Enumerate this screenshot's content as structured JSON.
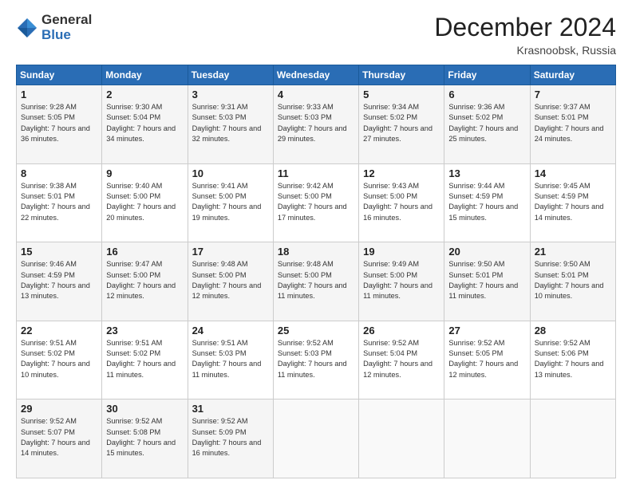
{
  "logo": {
    "general": "General",
    "blue": "Blue"
  },
  "title": "December 2024",
  "location": "Krasnoobsk, Russia",
  "days_of_week": [
    "Sunday",
    "Monday",
    "Tuesday",
    "Wednesday",
    "Thursday",
    "Friday",
    "Saturday"
  ],
  "weeks": [
    [
      {
        "day": "1",
        "sunrise": "9:28 AM",
        "sunset": "5:05 PM",
        "daylight": "7 hours and 36 minutes."
      },
      {
        "day": "2",
        "sunrise": "9:30 AM",
        "sunset": "5:04 PM",
        "daylight": "7 hours and 34 minutes."
      },
      {
        "day": "3",
        "sunrise": "9:31 AM",
        "sunset": "5:03 PM",
        "daylight": "7 hours and 32 minutes."
      },
      {
        "day": "4",
        "sunrise": "9:33 AM",
        "sunset": "5:03 PM",
        "daylight": "7 hours and 29 minutes."
      },
      {
        "day": "5",
        "sunrise": "9:34 AM",
        "sunset": "5:02 PM",
        "daylight": "7 hours and 27 minutes."
      },
      {
        "day": "6",
        "sunrise": "9:36 AM",
        "sunset": "5:02 PM",
        "daylight": "7 hours and 25 minutes."
      },
      {
        "day": "7",
        "sunrise": "9:37 AM",
        "sunset": "5:01 PM",
        "daylight": "7 hours and 24 minutes."
      }
    ],
    [
      {
        "day": "8",
        "sunrise": "9:38 AM",
        "sunset": "5:01 PM",
        "daylight": "7 hours and 22 minutes."
      },
      {
        "day": "9",
        "sunrise": "9:40 AM",
        "sunset": "5:00 PM",
        "daylight": "7 hours and 20 minutes."
      },
      {
        "day": "10",
        "sunrise": "9:41 AM",
        "sunset": "5:00 PM",
        "daylight": "7 hours and 19 minutes."
      },
      {
        "day": "11",
        "sunrise": "9:42 AM",
        "sunset": "5:00 PM",
        "daylight": "7 hours and 17 minutes."
      },
      {
        "day": "12",
        "sunrise": "9:43 AM",
        "sunset": "5:00 PM",
        "daylight": "7 hours and 16 minutes."
      },
      {
        "day": "13",
        "sunrise": "9:44 AM",
        "sunset": "4:59 PM",
        "daylight": "7 hours and 15 minutes."
      },
      {
        "day": "14",
        "sunrise": "9:45 AM",
        "sunset": "4:59 PM",
        "daylight": "7 hours and 14 minutes."
      }
    ],
    [
      {
        "day": "15",
        "sunrise": "9:46 AM",
        "sunset": "4:59 PM",
        "daylight": "7 hours and 13 minutes."
      },
      {
        "day": "16",
        "sunrise": "9:47 AM",
        "sunset": "5:00 PM",
        "daylight": "7 hours and 12 minutes."
      },
      {
        "day": "17",
        "sunrise": "9:48 AM",
        "sunset": "5:00 PM",
        "daylight": "7 hours and 12 minutes."
      },
      {
        "day": "18",
        "sunrise": "9:48 AM",
        "sunset": "5:00 PM",
        "daylight": "7 hours and 11 minutes."
      },
      {
        "day": "19",
        "sunrise": "9:49 AM",
        "sunset": "5:00 PM",
        "daylight": "7 hours and 11 minutes."
      },
      {
        "day": "20",
        "sunrise": "9:50 AM",
        "sunset": "5:01 PM",
        "daylight": "7 hours and 11 minutes."
      },
      {
        "day": "21",
        "sunrise": "9:50 AM",
        "sunset": "5:01 PM",
        "daylight": "7 hours and 10 minutes."
      }
    ],
    [
      {
        "day": "22",
        "sunrise": "9:51 AM",
        "sunset": "5:02 PM",
        "daylight": "7 hours and 10 minutes."
      },
      {
        "day": "23",
        "sunrise": "9:51 AM",
        "sunset": "5:02 PM",
        "daylight": "7 hours and 11 minutes."
      },
      {
        "day": "24",
        "sunrise": "9:51 AM",
        "sunset": "5:03 PM",
        "daylight": "7 hours and 11 minutes."
      },
      {
        "day": "25",
        "sunrise": "9:52 AM",
        "sunset": "5:03 PM",
        "daylight": "7 hours and 11 minutes."
      },
      {
        "day": "26",
        "sunrise": "9:52 AM",
        "sunset": "5:04 PM",
        "daylight": "7 hours and 12 minutes."
      },
      {
        "day": "27",
        "sunrise": "9:52 AM",
        "sunset": "5:05 PM",
        "daylight": "7 hours and 12 minutes."
      },
      {
        "day": "28",
        "sunrise": "9:52 AM",
        "sunset": "5:06 PM",
        "daylight": "7 hours and 13 minutes."
      }
    ],
    [
      {
        "day": "29",
        "sunrise": "9:52 AM",
        "sunset": "5:07 PM",
        "daylight": "7 hours and 14 minutes."
      },
      {
        "day": "30",
        "sunrise": "9:52 AM",
        "sunset": "5:08 PM",
        "daylight": "7 hours and 15 minutes."
      },
      {
        "day": "31",
        "sunrise": "9:52 AM",
        "sunset": "5:09 PM",
        "daylight": "7 hours and 16 minutes."
      },
      null,
      null,
      null,
      null
    ]
  ]
}
